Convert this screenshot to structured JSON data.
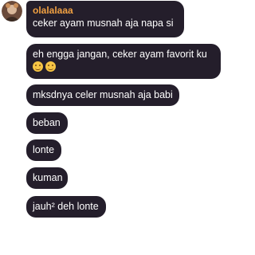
{
  "sender": {
    "name": "olalalaaa"
  },
  "messages": [
    {
      "text": "ceker ayam musnah aja napa si"
    },
    {
      "text": "eh engga jangan, ceker ayam favorit ku",
      "emojis": [
        "relieved-face-icon",
        "relieved-face-icon"
      ]
    },
    {
      "text": "mksdnya celer musnah aja babi"
    },
    {
      "text": "beban"
    },
    {
      "text": "lonte"
    },
    {
      "text": "kuman"
    },
    {
      "text": "jauh² deh lonte"
    }
  ],
  "colors": {
    "bubble_bg": "#241e2b",
    "text": "#ffffff",
    "sender_name": "#f0a042",
    "background": "#ffffff"
  }
}
